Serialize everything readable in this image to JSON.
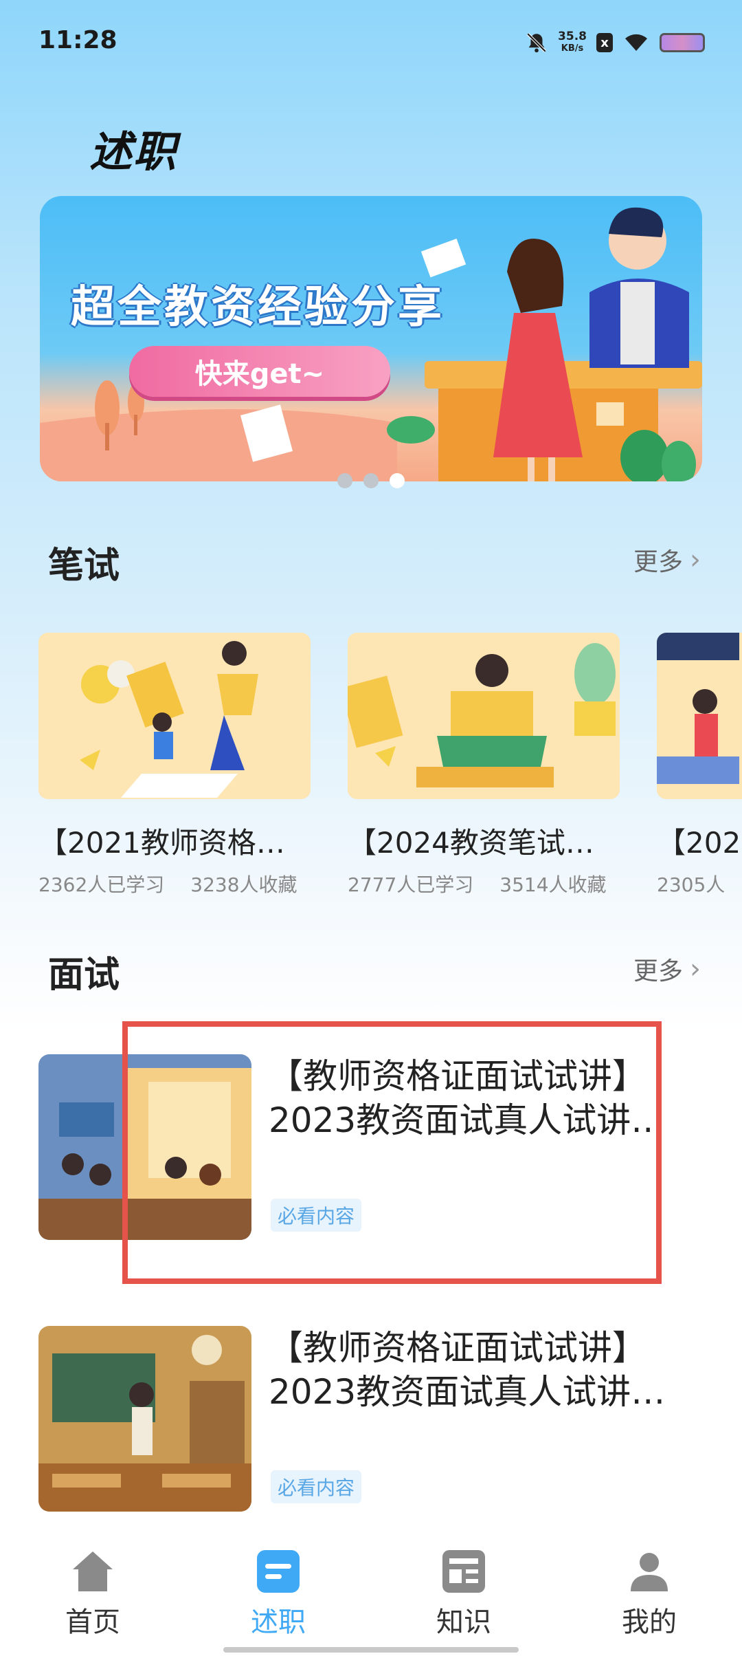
{
  "status_bar": {
    "time": "11:28",
    "net_speed_value": "35.8",
    "net_speed_unit": "KB/s",
    "sim_label": "x",
    "icons": [
      "bell-off-icon",
      "sim-icon",
      "wifi-icon",
      "battery-icon"
    ]
  },
  "page": {
    "title": "述职"
  },
  "banner": {
    "headline": "超全教资经验分享",
    "cta": "快来get~",
    "carousel_pages": 3,
    "active_page": 3
  },
  "written": {
    "title": "笔试",
    "more": "更多",
    "cards": [
      {
        "title": "【2021教师资格…",
        "learners": "2362人已学习",
        "favorites": "3238人收藏"
      },
      {
        "title": "【2024教资笔试…",
        "learners": "2777人已学习",
        "favorites": "3514人收藏"
      },
      {
        "title": "【202",
        "learners": "2305人",
        "favorites": ""
      }
    ]
  },
  "interview": {
    "title": "面试",
    "more": "更多",
    "items": [
      {
        "title_line1": "【教师资格证面试试讲】",
        "title_line2": "2023教资面试真人试讲…",
        "tag": "必看内容"
      },
      {
        "title_line1": "【教师资格证面试试讲】",
        "title_line2": "2023教资面试真人试讲…",
        "tag": "必看内容"
      }
    ]
  },
  "nav": {
    "items": [
      {
        "label": "首页",
        "icon": "home-icon",
        "active": false
      },
      {
        "label": "述职",
        "icon": "report-icon",
        "active": true
      },
      {
        "label": "知识",
        "icon": "knowledge-icon",
        "active": false
      },
      {
        "label": "我的",
        "icon": "profile-icon",
        "active": false
      }
    ]
  },
  "colors": {
    "accent": "#3fa9f5",
    "tag_text": "#5aa7e6",
    "highlight": "#e5534b"
  }
}
